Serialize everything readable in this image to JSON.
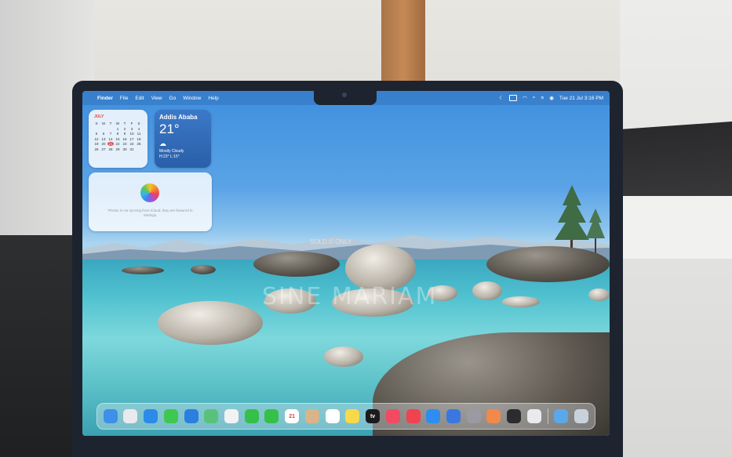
{
  "menubar": {
    "apple": "",
    "items": [
      "Finder",
      "File",
      "Edit",
      "View",
      "Go",
      "Window",
      "Help"
    ],
    "clock": "Tue 21 Jul 3:16 PM"
  },
  "calendar_widget": {
    "month": "JULY",
    "days": [
      "S",
      "M",
      "T",
      "W",
      "T",
      "F",
      "S",
      "",
      "",
      "",
      "1",
      "2",
      "3",
      "4",
      "5",
      "6",
      "7",
      "8",
      "9",
      "10",
      "11",
      "12",
      "13",
      "14",
      "15",
      "16",
      "17",
      "18",
      "19",
      "20",
      "21",
      "22",
      "23",
      "24",
      "25",
      "26",
      "27",
      "28",
      "29",
      "30",
      "31",
      ""
    ],
    "today": "21"
  },
  "weather_widget": {
    "city": "Addis Ababa",
    "temp": "21°",
    "icon": "cloud-icon",
    "condition": "Mostly Cloudy",
    "hilo": "H:23° L:15°"
  },
  "photos_widget": {
    "icon": "photos-icon",
    "message": "Photos is not syncing from iCloud; they are featured in Settings."
  },
  "dock": {
    "apps": [
      {
        "name": "finder",
        "label": "",
        "color": "#3d8fe8"
      },
      {
        "name": "launchpad",
        "label": "",
        "color": "#e9e9ee"
      },
      {
        "name": "safari",
        "label": "",
        "color": "#2c8ae8"
      },
      {
        "name": "messages",
        "label": "",
        "color": "#3fc850"
      },
      {
        "name": "mail",
        "label": "",
        "color": "#2b7fe0"
      },
      {
        "name": "maps",
        "label": "",
        "color": "#59c27a"
      },
      {
        "name": "photos",
        "label": "",
        "color": "#f2f2f2"
      },
      {
        "name": "facetime",
        "label": "",
        "color": "#35c04a"
      },
      {
        "name": "phone",
        "label": "",
        "color": "#35c04a"
      },
      {
        "name": "calendar",
        "label": "21",
        "color": "#ffffff"
      },
      {
        "name": "contacts",
        "label": "",
        "color": "#d9b48a"
      },
      {
        "name": "reminders",
        "label": "",
        "color": "#ffffff"
      },
      {
        "name": "notes",
        "label": "",
        "color": "#f8d94a"
      },
      {
        "name": "tv",
        "label": "tv",
        "color": "#1b1b1d"
      },
      {
        "name": "music",
        "label": "",
        "color": "#f24a63"
      },
      {
        "name": "news",
        "label": "",
        "color": "#f0434f"
      },
      {
        "name": "app-store",
        "label": "",
        "color": "#2f8cf0"
      },
      {
        "name": "keynote",
        "label": "",
        "color": "#3a78e0"
      },
      {
        "name": "settings",
        "label": "",
        "color": "#9a9aa2"
      },
      {
        "name": "books",
        "label": "",
        "color": "#f0894b"
      },
      {
        "name": "iphone-mirroring",
        "label": "",
        "color": "#2c2c2e"
      },
      {
        "name": "preview",
        "label": "",
        "color": "#e9e9ee"
      },
      {
        "name": "downloads",
        "label": "",
        "color": "#5aa8e8"
      },
      {
        "name": "trash",
        "label": "",
        "color": "#c9d2da"
      }
    ]
  },
  "watermark": "SINE MARIAM",
  "watermark_small": "SOLD © ONLY"
}
